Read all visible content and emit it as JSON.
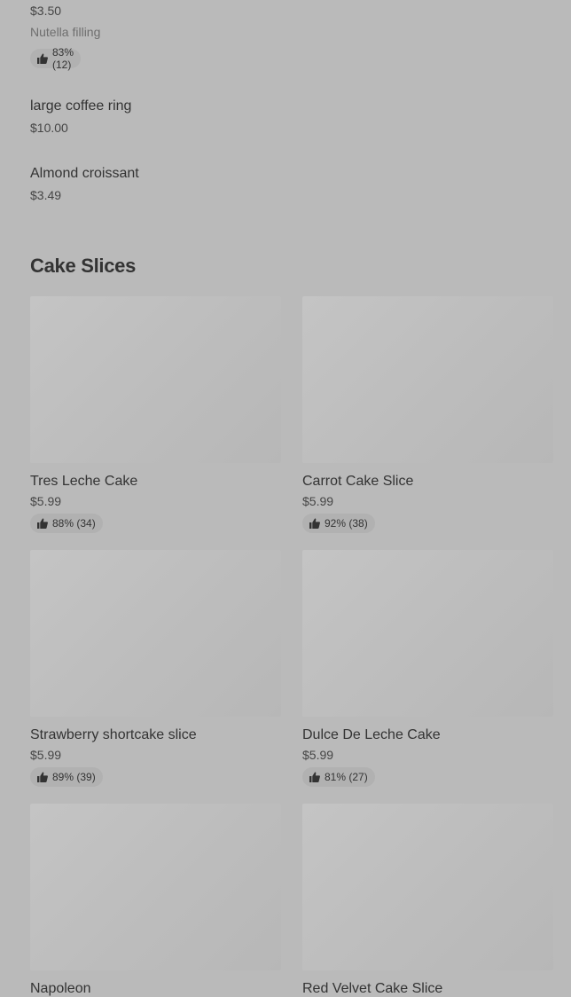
{
  "top_items": [
    {
      "price": "$3.50",
      "description": "Nutella filling",
      "rating": "83% (12)"
    },
    {
      "name": "large coffee ring",
      "price": "$10.00"
    },
    {
      "name": "Almond croissant",
      "price": "$3.49"
    }
  ],
  "section": {
    "title": "Cake Slices"
  },
  "cards": [
    {
      "name": "Tres Leche Cake",
      "price": "$5.99",
      "rating": "88% (34)"
    },
    {
      "name": "Carrot Cake Slice",
      "price": "$5.99",
      "rating": "92% (38)"
    },
    {
      "name": "Strawberry shortcake slice",
      "price": "$5.99",
      "rating": "89% (39)"
    },
    {
      "name": "Dulce De Leche Cake",
      "price": "$5.99",
      "rating": "81% (27)"
    },
    {
      "name": "Napoleon"
    },
    {
      "name": "Red Velvet Cake Slice"
    }
  ],
  "icons": {
    "rating": "thumbs-up-icon"
  },
  "colors": {
    "background": "#bababa",
    "text": "#333333",
    "pill": "#b1b1b1"
  }
}
